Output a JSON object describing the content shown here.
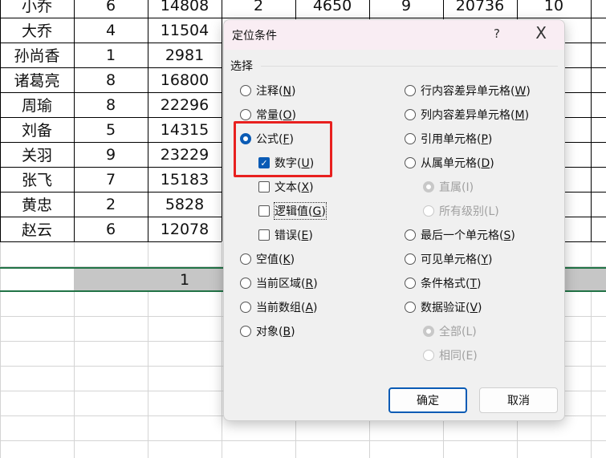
{
  "sheet": {
    "rows": [
      [
        "小乔",
        "6",
        "14808",
        "2",
        "4650",
        "9",
        "20736",
        "10"
      ],
      [
        "大乔",
        "4",
        "11504"
      ],
      [
        "孙尚香",
        "1",
        "2981"
      ],
      [
        "诸葛亮",
        "8",
        "16800"
      ],
      [
        "周瑜",
        "8",
        "22296"
      ],
      [
        "刘备",
        "5",
        "14315"
      ],
      [
        "关羽",
        "9",
        "23229"
      ],
      [
        "张飞",
        "7",
        "15183"
      ],
      [
        "黄忠",
        "2",
        "5828"
      ],
      [
        "赵云",
        "6",
        "12078"
      ]
    ],
    "selected_row_value": "1"
  },
  "dialog": {
    "title": "定位条件",
    "help": "?",
    "close": "X",
    "group": "选择",
    "left": [
      {
        "pre": "注释(",
        "key": "N",
        "post": ")",
        "type": "radio",
        "checked": false
      },
      {
        "pre": "常量(",
        "key": "O",
        "post": ")",
        "type": "radio",
        "checked": false
      },
      {
        "pre": "公式(",
        "key": "F",
        "post": ")",
        "type": "radio",
        "checked": true
      },
      {
        "pre": "数字(",
        "key": "U",
        "post": ")",
        "type": "check",
        "checked": true
      },
      {
        "pre": "文本(",
        "key": "X",
        "post": ")",
        "type": "check",
        "checked": false
      },
      {
        "pre": "逻辑值(",
        "key": "G",
        "post": ")",
        "type": "check",
        "checked": false
      },
      {
        "pre": "错误(",
        "key": "E",
        "post": ")",
        "type": "check",
        "checked": false
      },
      {
        "pre": "空值(",
        "key": "K",
        "post": ")",
        "type": "radio",
        "checked": false
      },
      {
        "pre": "当前区域(",
        "key": "R",
        "post": ")",
        "type": "radio",
        "checked": false
      },
      {
        "pre": "当前数组(",
        "key": "A",
        "post": ")",
        "type": "radio",
        "checked": false
      },
      {
        "pre": "对象(",
        "key": "B",
        "post": ")",
        "type": "radio",
        "checked": false
      }
    ],
    "right": [
      {
        "pre": "行内容差异单元格(",
        "key": "W",
        "post": ")",
        "checked": false
      },
      {
        "pre": "列内容差异单元格(",
        "key": "M",
        "post": ")",
        "checked": false
      },
      {
        "pre": "引用单元格(",
        "key": "P",
        "post": ")",
        "checked": false
      },
      {
        "pre": "从属单元格(",
        "key": "D",
        "post": ")",
        "checked": false
      },
      {
        "pre": "直属(I)",
        "key": "",
        "post": "",
        "checked": true,
        "disabled": true
      },
      {
        "pre": "所有级别(L)",
        "key": "",
        "post": "",
        "checked": false,
        "disabled": true
      },
      {
        "pre": "最后一个单元格(",
        "key": "S",
        "post": ")",
        "checked": false
      },
      {
        "pre": "可见单元格(",
        "key": "Y",
        "post": ")",
        "checked": false
      },
      {
        "pre": "条件格式(",
        "key": "T",
        "post": ")",
        "checked": false
      },
      {
        "pre": "数据验证(",
        "key": "V",
        "post": ")",
        "checked": false
      },
      {
        "pre": "全部(L)",
        "key": "",
        "post": "",
        "checked": true,
        "disabled": true
      },
      {
        "pre": "相同(E)",
        "key": "",
        "post": "",
        "checked": false,
        "disabled": true
      }
    ],
    "ok": "确定",
    "cancel": "取消"
  }
}
